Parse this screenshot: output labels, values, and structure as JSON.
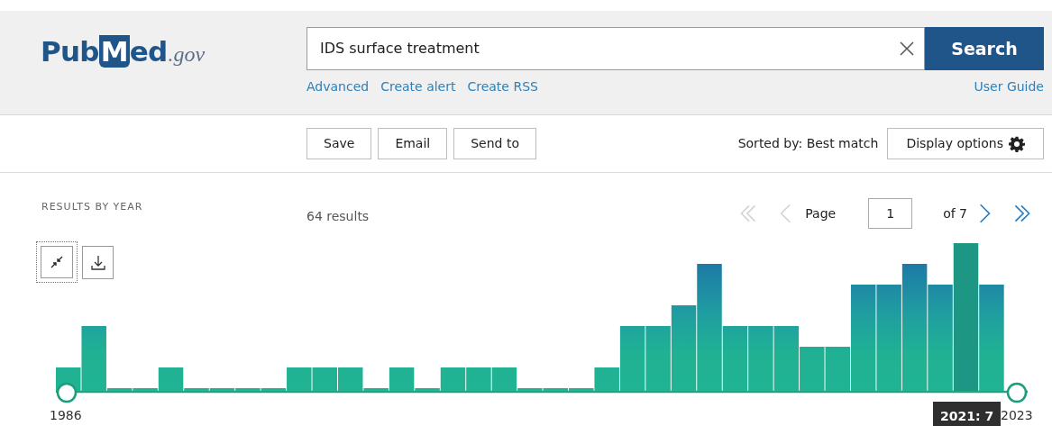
{
  "header": {
    "logo": {
      "parts": [
        "Pub",
        "M",
        "ed"
      ],
      "domain": ".gov"
    },
    "search": {
      "value": "IDS surface treatment",
      "button": "Search"
    },
    "links": [
      "Advanced",
      "Create alert",
      "Create RSS"
    ],
    "user_guide": "User Guide"
  },
  "toolbar": {
    "actions": [
      "Save",
      "Email",
      "Send to"
    ],
    "sort": "Sorted by: Best match",
    "display_options": "Display options"
  },
  "timeline": {
    "title": "RESULTS BY YEAR",
    "start_year": "1986",
    "end_year": "2023",
    "tooltip": "2021: 7"
  },
  "results": {
    "count": "64 results",
    "pager": {
      "first_disabled": true,
      "prev_disabled": true,
      "label": "Page",
      "page": "1",
      "total": "of 7",
      "next_disabled": false,
      "last_disabled": false
    }
  }
}
